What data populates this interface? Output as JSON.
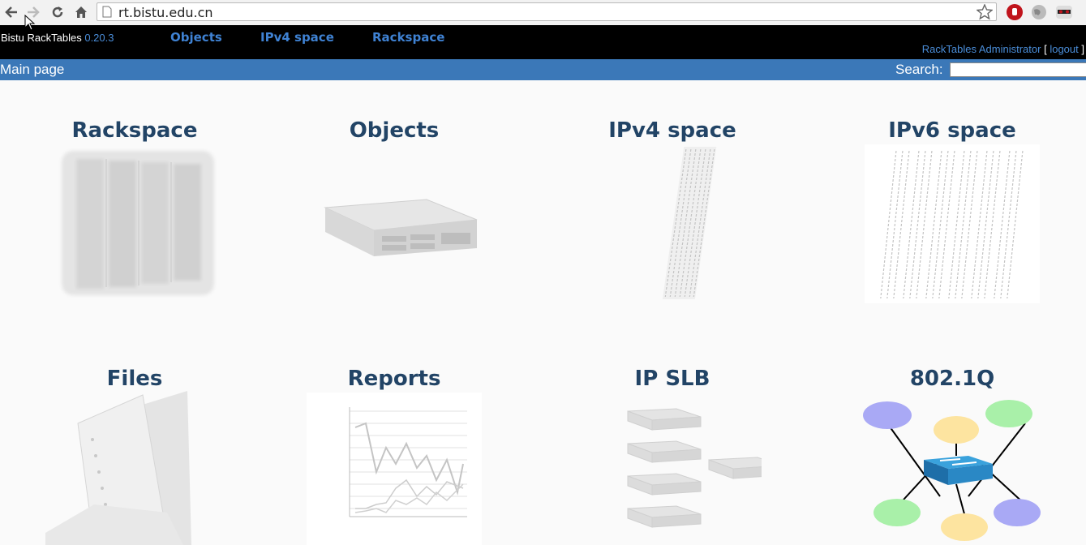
{
  "browser": {
    "url": "rt.bistu.edu.cn"
  },
  "header": {
    "brand": "Bistu RackTables",
    "version": "0.20.3",
    "tabs": [
      "Objects",
      "IPv4 space",
      "Rackspace"
    ],
    "user": "RackTables Administrator",
    "bracket_open": "[",
    "logout": "logout",
    "bracket_close": "]"
  },
  "pathbar": {
    "crumb": "Main page",
    "search_label": "Search:"
  },
  "tiles": [
    {
      "title": "Rackspace",
      "icon": "rack-cabinet-icon"
    },
    {
      "title": "Objects",
      "icon": "server-icon"
    },
    {
      "title": "IPv4 space",
      "icon": "ipv4-address-column-icon"
    },
    {
      "title": "IPv6 space",
      "icon": "ipv6-address-columns-icon"
    },
    {
      "title": "Files",
      "icon": "document-folder-icon"
    },
    {
      "title": "Reports",
      "icon": "line-chart-report-icon"
    },
    {
      "title": "IP SLB",
      "icon": "server-cluster-icon"
    },
    {
      "title": "802.1Q",
      "icon": "network-switch-vlan-icon"
    }
  ],
  "colors": {
    "topbar": "#000000",
    "pathbar": "#3b78b8",
    "tab_link": "#3f82d3",
    "tile_title": "#224466"
  }
}
